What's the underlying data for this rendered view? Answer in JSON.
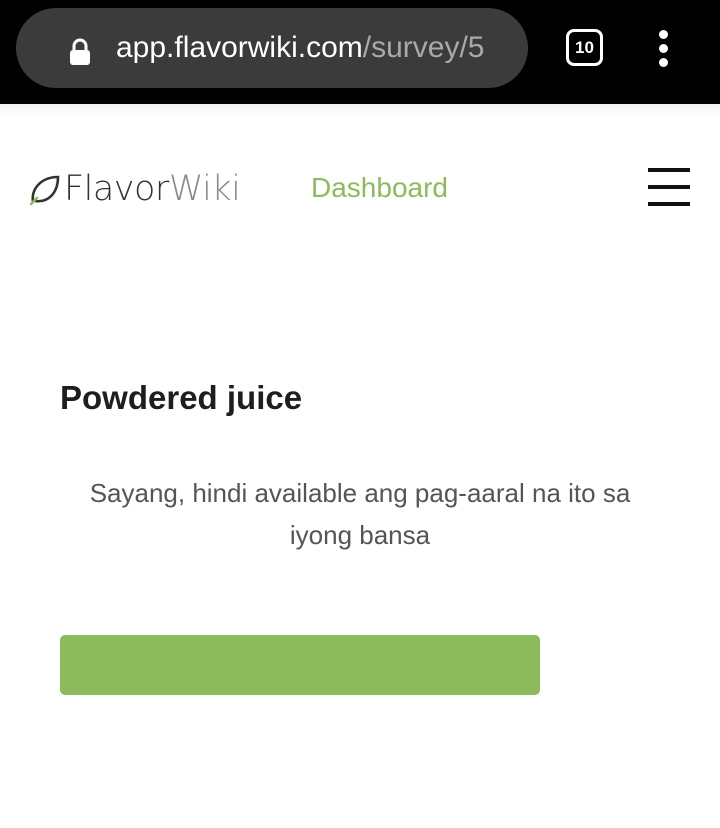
{
  "browser": {
    "url_domain": "app.flavorwiki.com",
    "url_path": "/survey/5",
    "tab_count": "10"
  },
  "header": {
    "logo_text_flavor": "Flavor",
    "logo_text_wiki": "Wiki",
    "nav_link": "Dashboard"
  },
  "content": {
    "title": "Powdered juice",
    "message": "Sayang, hindi available ang pag-aaral na ito sa iyong bansa",
    "button_label": ""
  },
  "colors": {
    "brand_green": "#8cbb5d",
    "browser_bar": "#000000",
    "url_pill": "#3b3b3b"
  },
  "icons": {
    "lock": "lock-icon",
    "overflow": "more-vertical-icon",
    "menu": "hamburger-menu-icon",
    "logo": "leaf-icon"
  }
}
